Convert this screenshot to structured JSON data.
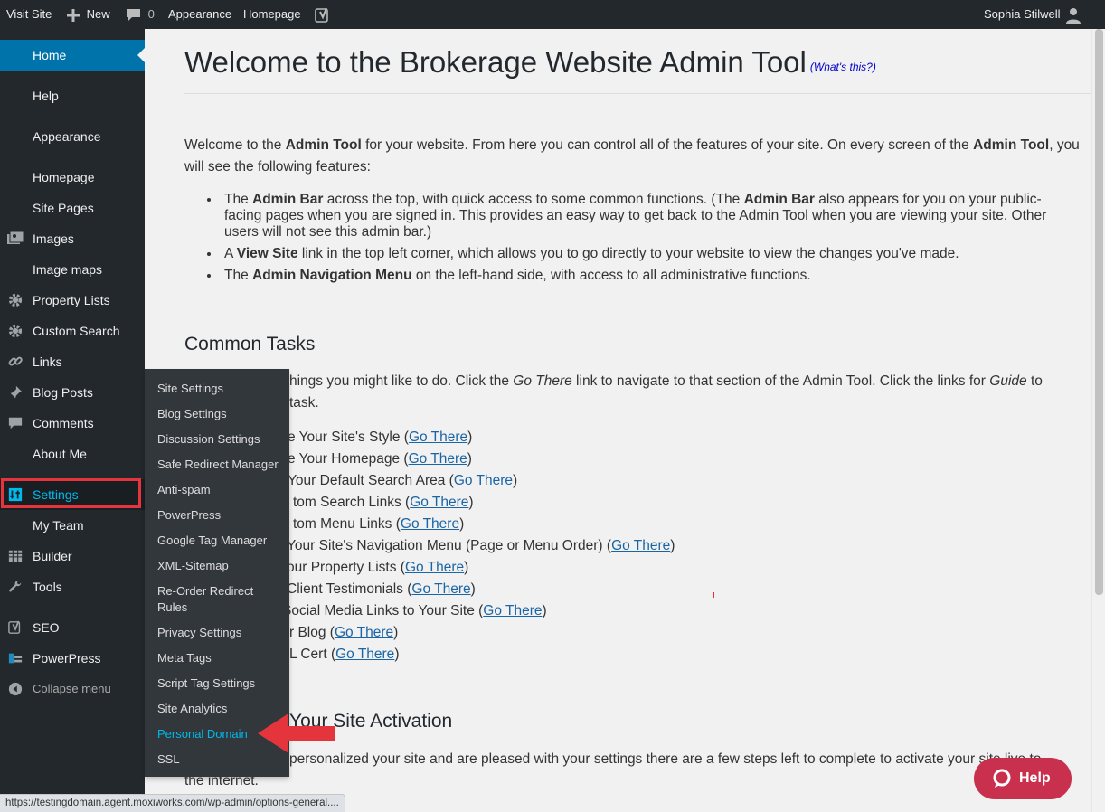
{
  "adminbar": {
    "visit_site": "Visit Site",
    "new": "New",
    "comments_count": "0",
    "appearance": "Appearance",
    "homepage": "Homepage",
    "user": "Sophia Stilwell"
  },
  "sidebar": {
    "items": [
      {
        "label": "Home",
        "icon": "home-icon"
      },
      {
        "label": "Help",
        "icon": ""
      },
      {
        "label": "Appearance",
        "icon": ""
      },
      {
        "label": "Homepage",
        "icon": ""
      },
      {
        "label": "Site Pages",
        "icon": ""
      },
      {
        "label": "Images",
        "icon": "images-icon"
      },
      {
        "label": "Image maps",
        "icon": ""
      },
      {
        "label": "Property Lists",
        "icon": "gear-icon"
      },
      {
        "label": "Custom Search",
        "icon": "gear-icon"
      },
      {
        "label": "Links",
        "icon": "link-icon"
      },
      {
        "label": "Blog Posts",
        "icon": "pin-icon"
      },
      {
        "label": "Comments",
        "icon": "comment-icon"
      },
      {
        "label": "About Me",
        "icon": ""
      },
      {
        "label": "Settings",
        "icon": "settings-icon"
      },
      {
        "label": "My Team",
        "icon": ""
      },
      {
        "label": "Builder",
        "icon": "table-icon"
      },
      {
        "label": "Tools",
        "icon": "wrench-icon"
      },
      {
        "label": "SEO",
        "icon": "yoast-icon"
      },
      {
        "label": "PowerPress",
        "icon": "podcast-icon"
      },
      {
        "label": "Collapse menu",
        "icon": "collapse-icon"
      }
    ]
  },
  "submenu": {
    "items": [
      "Site Settings",
      "Blog Settings",
      "Discussion Settings",
      "Safe Redirect Manager",
      "Anti-spam",
      "PowerPress",
      "Google Tag Manager",
      "XML-Sitemap",
      "Re-Order Redirect Rules",
      "Privacy Settings",
      "Meta Tags",
      "Script Tag Settings",
      "Site Analytics",
      "Personal Domain",
      "SSL"
    ]
  },
  "main": {
    "title": "Welcome to the Brokerage Website Admin Tool",
    "whats_this": "(What's this?)",
    "intro_1": "Welcome to the ",
    "intro_b1": "Admin Tool",
    "intro_2": " for your website. From here you can control all of the features of your site. On every screen of the ",
    "intro_b2": "Admin Tool",
    "intro_3": ", you will see the following features:",
    "bullet1_a": "The ",
    "bullet1_b": "Admin Bar",
    "bullet1_c": " across the top, with quick access to some common functions. (The ",
    "bullet1_d": "Admin Bar",
    "bullet1_e": " also appears for you on your public-facing pages when you are signed in. This provides an easy way to get back to the Admin Tool when you are viewing your site. Other users will not see this admin bar.)",
    "bullet2_a": "A ",
    "bullet2_b": "View Site",
    "bullet2_c": " link in the top left corner, which allows you to go directly to your website to view the changes you've made.",
    "bullet3_a": "The ",
    "bullet3_b": "Admin Navigation Menu",
    "bullet3_c": " on the left-hand side, with access to all administrative functions.",
    "common_tasks_heading": "Common Tasks",
    "common_intro_1": "hings you might like to do. Click the ",
    "common_intro_em1": "Go There",
    "common_intro_2": " link to navigate to that section of the Admin Tool. Click the links for ",
    "common_intro_em2": "Guide",
    "common_intro_3": " to",
    "common_intro_line2": " task.",
    "tasks": [
      {
        "text": "e Your Site's Style (",
        "link": "Go There",
        "end": ")"
      },
      {
        "text": "e Your Homepage (",
        "link": "Go There",
        "end": ")"
      },
      {
        "text": " Your Default Search Area (",
        "link": "Go There",
        "end": ")"
      },
      {
        "text": "tom Search Links (",
        "link": "Go There",
        "end": ")"
      },
      {
        "text": "tom Menu Links (",
        "link": "Go There",
        "end": ")"
      },
      {
        "text": "Your Site's Navigation Menu (Page or Menu Order) (",
        "link": "Go There",
        "end": ")"
      },
      {
        "text": "our Property Lists (",
        "link": "Go There",
        "end": ")"
      },
      {
        "text": "Client Testimonials (",
        "link": "Go There",
        "end": ")"
      },
      {
        "text": "Social Media Links to Your Site (",
        "link": "Go There",
        "end": ")"
      },
      {
        "text": "r Blog (",
        "link": "Go There",
        "end": ")"
      },
      {
        "text": "L Cert (",
        "link": "Go There",
        "end": ")"
      }
    ],
    "activation_heading": "Your Site Activation",
    "activation_text": "personalized your site and are pleased with your settings there are a few steps left to complete to activate your site live to",
    "activation_text2": "the internet."
  },
  "help_button": "Help",
  "status_url": "https://testingdomain.agent.moxiworks.com/wp-admin/options-general....",
  "colors": {
    "adminbar": "#23282d",
    "current_menu": "#0073aa",
    "highlight": "#e4353c",
    "help_button": "#c9304d",
    "active_submenu": "#00b9eb"
  }
}
